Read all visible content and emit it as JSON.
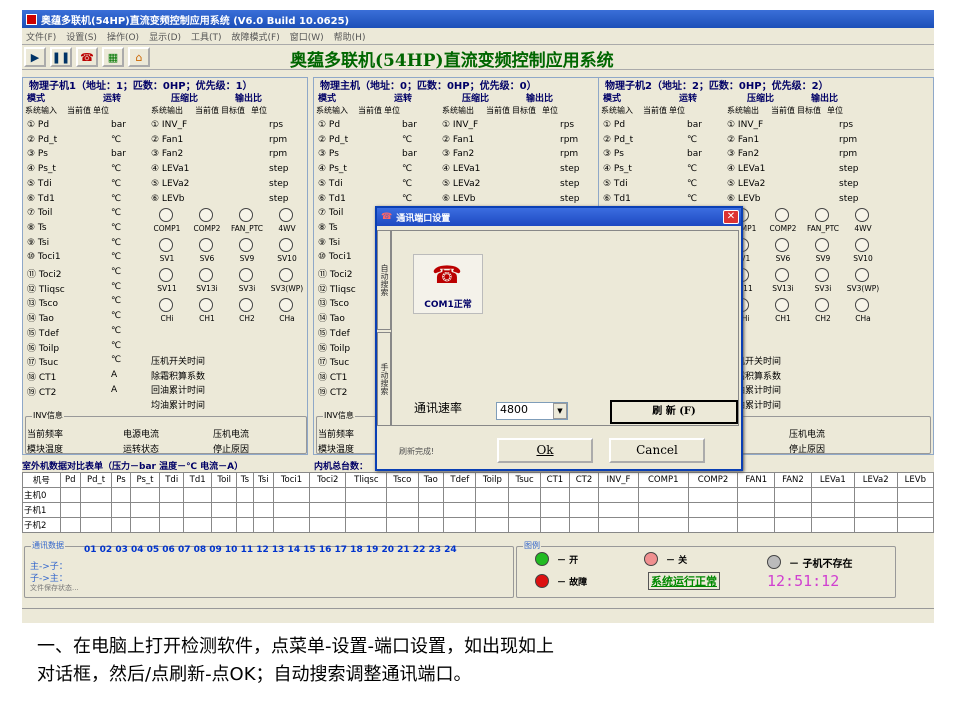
{
  "window": {
    "title": "奥蕴多联机(54HP)直流变频控制应用系统 (V6.0 Build 10.0625)",
    "app_title": "奥蕴多联机(54HP)直流变频控制应用系统"
  },
  "menu": [
    "文件(F)",
    "设置(S)",
    "操作(O)",
    "显示(D)",
    "工具(T)",
    "故障模式(F)",
    "窗口(W)",
    "帮助(H)"
  ],
  "panels": [
    {
      "title": "物理子机1（地址：1；匹数：0HP；优先级：1）",
      "mode": "模式",
      "run": "运转",
      "comp": "压缩比",
      "outr": "输出比",
      "sub_in": "系统输入",
      "sub_cur": "当前值",
      "sub_unit": "单位",
      "sub_out": "系统输出",
      "sub_cur2": "当前值",
      "sub_tgt": "目标值",
      "sub_unit2": "单位"
    },
    {
      "title": "物理主机（地址：0；匹数：0HP；优先级：0）",
      "mode": "模式",
      "run": "运转",
      "comp": "压缩比",
      "outr": "输出比",
      "sub_in": "系统输入",
      "sub_cur": "当前值",
      "sub_unit": "单位",
      "sub_out": "系统输出",
      "sub_cur2": "当前值",
      "sub_tgt": "目标值",
      "sub_unit2": "单位"
    },
    {
      "title": "物理子机2（地址：2；匹数：0HP；优先级：2）",
      "mode": "模式",
      "run": "运转",
      "comp": "压缩比",
      "outr": "输出比",
      "sub_in": "系统输入",
      "sub_cur": "当前值",
      "sub_unit": "单位",
      "sub_out": "系统输出",
      "sub_cur2": "当前值",
      "sub_tgt": "目标值",
      "sub_unit2": "单位"
    }
  ],
  "inputs": [
    {
      "l": "① Pd",
      "u": "bar"
    },
    {
      "l": "② Pd_t",
      "u": "℃"
    },
    {
      "l": "③ Ps",
      "u": "bar"
    },
    {
      "l": "④ Ps_t",
      "u": "℃"
    },
    {
      "l": "⑤ Tdi",
      "u": "℃"
    },
    {
      "l": "⑥ Td1",
      "u": "℃"
    },
    {
      "l": "⑦ Toil",
      "u": "℃"
    },
    {
      "l": "⑧ Ts",
      "u": "℃"
    },
    {
      "l": "⑨ Tsi",
      "u": "℃"
    },
    {
      "l": "⑩ Toci1",
      "u": "℃"
    },
    {
      "l": "⑪ Toci2",
      "u": "℃"
    },
    {
      "l": "⑫ Tliqsc",
      "u": "℃"
    },
    {
      "l": "⑬ Tsco",
      "u": "℃"
    },
    {
      "l": "⑭ Tao",
      "u": "℃"
    },
    {
      "l": "⑮ Tdef",
      "u": "℃"
    },
    {
      "l": "⑯ Toilp",
      "u": "℃"
    },
    {
      "l": "⑰ Tsuc",
      "u": "℃"
    },
    {
      "l": "⑱ CT1",
      "u": "A"
    },
    {
      "l": "⑲ CT2",
      "u": "A"
    }
  ],
  "outputs": [
    {
      "l": "① INV_F",
      "u": "rps"
    },
    {
      "l": "② Fan1",
      "u": "rpm"
    },
    {
      "l": "③ Fan2",
      "u": "rpm"
    },
    {
      "l": "④ LEVa1",
      "u": "step"
    },
    {
      "l": "⑤ LEVa2",
      "u": "step"
    },
    {
      "l": "⑥ LEVb",
      "u": "step"
    }
  ],
  "circle_rows": [
    [
      "COMP1",
      "COMP2",
      "FAN_PTC",
      "4WV"
    ],
    [
      "SV1",
      "SV6",
      "SV9",
      "SV10"
    ],
    [
      "SV11",
      "SV13i",
      "SV3i",
      "SV3(WP)"
    ],
    [
      "CHi",
      "CH1",
      "CH2",
      "CHa"
    ]
  ],
  "side_items": [
    "压机开关时间",
    "除霜积算系数",
    "回油累计时间",
    "均油累计时间"
  ],
  "inv": {
    "title": "INV信息",
    "row1": [
      "当前频率",
      "电源电流",
      "压机电流"
    ],
    "row2": [
      "模块温度",
      "运转状态",
      "停止原因"
    ]
  },
  "table_caption": "室外机数据对比表单（压力－bar  温度－℃  电流－A）",
  "table_caption2": "内机总台数：",
  "table_headers": [
    "机号",
    "Pd",
    "Pd_t",
    "Ps",
    "Ps_t",
    "Tdi",
    "Td1",
    "Toil",
    "Ts",
    "Tsi",
    "Toci1",
    "Toci2",
    "Tliqsc",
    "Tsco",
    "Tao",
    "Tdef",
    "Toilp",
    "Tsuc",
    "CT1",
    "CT2",
    "INV_F",
    "COMP1",
    "COMP2",
    "FAN1",
    "FAN2",
    "LEVa1",
    "LEVa2",
    "LEVb"
  ],
  "table_rows": [
    "主机0",
    "子机1",
    "子机2"
  ],
  "comm": {
    "title": "通讯数据",
    "numbers": "01 02 03 04 05 06 07 08 09 10 11 12 13 14 15 16 17 18 19 20 21 22 23 24",
    "master_to_sub": "主->子：",
    "sub_to_master": "子->主：",
    "file_status": "文件保存状态..."
  },
  "legend": {
    "title": "图例",
    "on": "－ 开",
    "off": "－ 关",
    "fault": "－ 故障",
    "absent": "－ 子机不存在",
    "status": "系统运行正常",
    "time": "12:51:12",
    "colors": {
      "on": "#22bb22",
      "off": "#f09090",
      "fault": "#dd1111",
      "absent": "#bbbbbb",
      "time": "#d040d0"
    }
  },
  "dialog": {
    "title": "通讯端口设置",
    "tab_auto": "自动搜索",
    "tab_manual": "手动搜索",
    "port_status": "COM1正常",
    "baud_label": "通讯速率",
    "baud_value": "4800",
    "refresh": "刷 新 (F)",
    "status": "刷新完成!",
    "ok": "Ok",
    "cancel": "Cancel"
  },
  "caption": {
    "line1": "一、在电脑上打开检测软件，点菜单-设置-端口设置，如出现如上",
    "line2": "对话框，然后/点刷新-点OK；自动搜索调整通讯端口。"
  }
}
